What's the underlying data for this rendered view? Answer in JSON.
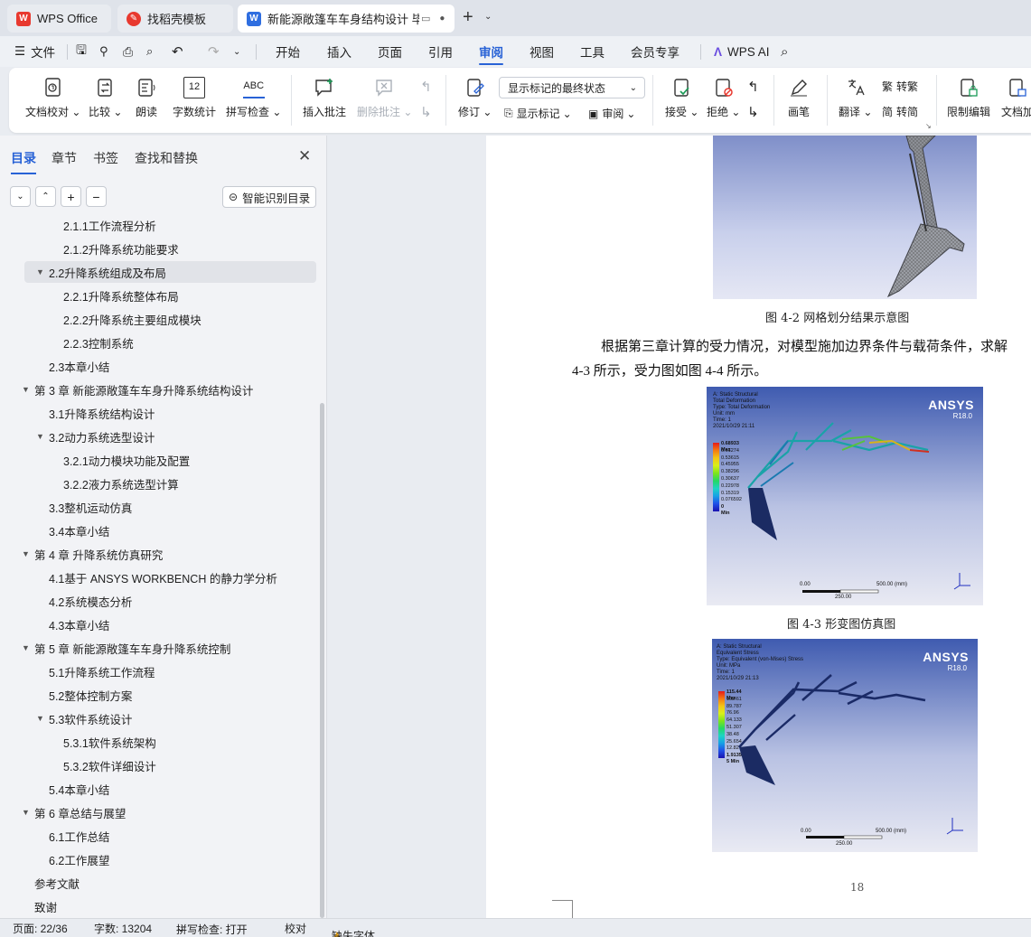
{
  "tabs": [
    {
      "label": "WPS Office"
    },
    {
      "label": "找稻壳模板"
    },
    {
      "label": "新能源敞篷车车身结构设计 毕"
    }
  ],
  "menu": {
    "file": "文件",
    "items": [
      "开始",
      "插入",
      "页面",
      "引用",
      "审阅",
      "视图",
      "工具",
      "会员专享"
    ],
    "active": "审阅",
    "wps_ai": "WPS AI"
  },
  "ribbon": {
    "doc_check": "文档校对",
    "compare": "比较",
    "read": "朗读",
    "word_count": "字数统计",
    "spell_check": "拼写检查",
    "spell_icon": "ABC",
    "count_icon": "12",
    "insert_comment": "插入批注",
    "delete_comment": "删除批注",
    "revise": "修订",
    "display_state": "显示标记的最终状态",
    "show_markup": "显示标记",
    "review": "审阅",
    "accept": "接受",
    "reject": "拒绝",
    "pen": "画笔",
    "translate": "翻译",
    "trad": "转繁",
    "simp": "转简",
    "restrict": "限制编辑",
    "doc_enc": "文档加"
  },
  "panel": {
    "tabs": [
      "目录",
      "章节",
      "书签",
      "查找和替换"
    ],
    "active_tab": "目录",
    "smart_button": "智能识别目录",
    "toc": [
      {
        "text": "2.1.1工作流程分析",
        "level": 3
      },
      {
        "text": "2.1.2升降系统功能要求",
        "level": 3
      },
      {
        "text": "2.2升降系统组成及布局",
        "level": 2,
        "expanded": true,
        "selected": true
      },
      {
        "text": "2.2.1升降系统整体布局",
        "level": 3
      },
      {
        "text": "2.2.2升降系统主要组成模块",
        "level": 3
      },
      {
        "text": "2.2.3控制系统",
        "level": 3
      },
      {
        "text": "2.3本章小结",
        "level": 2
      },
      {
        "text": "第 3 章 新能源敞篷车车身升降系统结构设计",
        "level": 1,
        "expanded": true
      },
      {
        "text": "3.1升降系统结构设计",
        "level": 2
      },
      {
        "text": "3.2动力系统选型设计",
        "level": 2,
        "expanded": true
      },
      {
        "text": "3.2.1动力模块功能及配置",
        "level": 3
      },
      {
        "text": "3.2.2液力系统选型计算",
        "level": 3
      },
      {
        "text": "3.3整机运动仿真",
        "level": 2
      },
      {
        "text": "3.4本章小结",
        "level": 2
      },
      {
        "text": "第 4 章 升降系统仿真研究",
        "level": 1,
        "expanded": true
      },
      {
        "text": "4.1基于 ANSYS WORKBENCH 的静力学分析",
        "level": 2
      },
      {
        "text": "4.2系统模态分析",
        "level": 2
      },
      {
        "text": "4.3本章小结",
        "level": 2
      },
      {
        "text": "第 5 章 新能源敞篷车车身升降系统控制",
        "level": 1,
        "expanded": true
      },
      {
        "text": "5.1升降系统工作流程",
        "level": 2
      },
      {
        "text": "5.2整体控制方案",
        "level": 2
      },
      {
        "text": "5.3软件系统设计",
        "level": 2,
        "expanded": true
      },
      {
        "text": "5.3.1软件系统架构",
        "level": 3
      },
      {
        "text": "5.3.2软件详细设计",
        "level": 3
      },
      {
        "text": "5.4本章小结",
        "level": 2
      },
      {
        "text": "第 6 章总结与展望",
        "level": 1,
        "expanded": true
      },
      {
        "text": "6.1工作总结",
        "level": 2
      },
      {
        "text": "6.2工作展望",
        "level": 2
      },
      {
        "text": "参考文献",
        "level": 1
      },
      {
        "text": "致谢",
        "level": 1
      }
    ]
  },
  "document": {
    "fig2_caption": "图 4-2 网格划分结果示意图",
    "para_line1": "根据第三章计算的受力情况，对模型施加边界条件与载荷条件，求解",
    "para_line2": "4-3 所示，受力图如图 4-4 所示。",
    "fig3_caption": "图 4-3 形变图仿真图",
    "page_number": "18",
    "fig3": {
      "logo": "ANSYS",
      "version": "R18.0",
      "header": "A: Static Structural\nTotal Deformation\nType: Total Deformation\nUnit: mm\nTime: 1\n2021/10/29 21:11",
      "legend": [
        "0.68933 Max",
        "0.61274",
        "0.53615",
        "0.45955",
        "0.38296",
        "0.30637",
        "0.22978",
        "0.15319",
        "0.076592",
        "0 Min"
      ],
      "scale_left": "0.00",
      "scale_right": "500.00 (mm)",
      "scale_mid": "250.00"
    },
    "fig4": {
      "logo": "ANSYS",
      "version": "R18.0",
      "header": "A: Static Structural\nEquivalent Stress\nType: Equivalent (von-Mises) Stress\nUnit: MPa\nTime: 1\n2021/10/29 21:13",
      "legend": [
        "115.44 Max",
        "102.61",
        "89.787",
        "76.96",
        "64.133",
        "51.307",
        "38.48",
        "25.654",
        "12.827",
        "1.9135e-5 Min"
      ],
      "scale_left": "0.00",
      "scale_right": "500.00 (mm)",
      "scale_mid": "250.00"
    }
  },
  "status": {
    "page": "页面: 22/36",
    "words": "字数: 13204",
    "spell": "拼写检查: 打开",
    "proof": "校对",
    "missing_font": "缺失字体"
  },
  "colors": {
    "accent": "#2862d6",
    "wps_red": "#e8392f"
  }
}
